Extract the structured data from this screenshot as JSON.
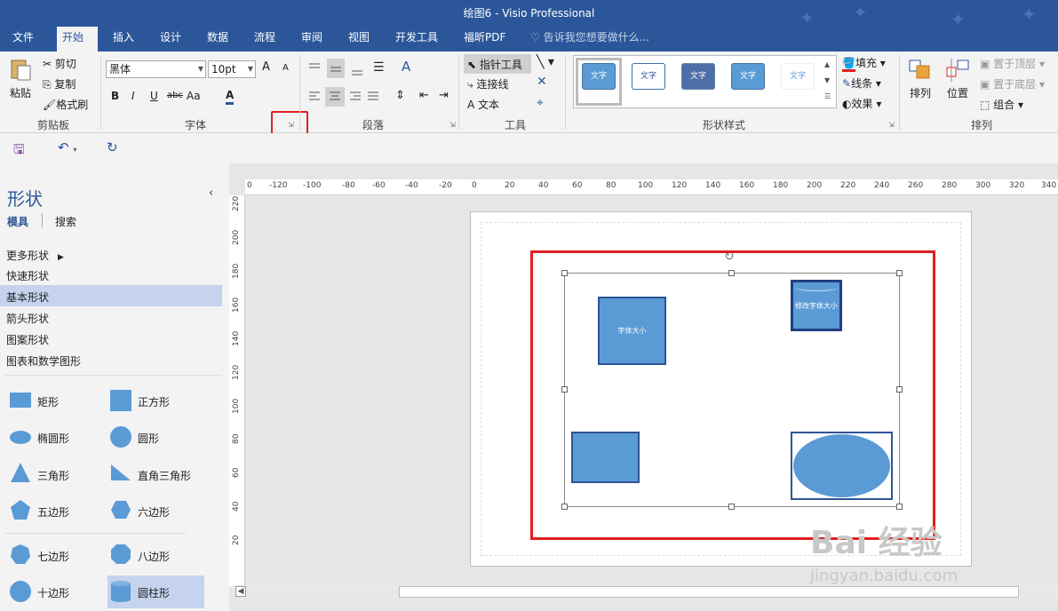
{
  "window": {
    "title": "绘图6 - Visio Professional"
  },
  "tabs": [
    "文件",
    "开始",
    "插入",
    "设计",
    "数据",
    "流程",
    "审阅",
    "视图",
    "开发工具",
    "福昕PDF"
  ],
  "active_tab": "开始",
  "tell_me": "告诉我您想要做什么...",
  "clipboard": {
    "paste": "粘贴",
    "cut": "剪切",
    "copy": "复制",
    "format_painter": "格式刷",
    "label": "剪贴板"
  },
  "font": {
    "name": "黑体",
    "size": "10pt",
    "label": "字体",
    "bold": "B",
    "italic": "I",
    "underline": "U",
    "strike": "abc",
    "case": "Aa",
    "color": "A",
    "grow": "A",
    "shrink": "A"
  },
  "paragraph": {
    "label": "段落"
  },
  "tools": {
    "pointer": "指针工具",
    "connector": "连接线",
    "text": "文本",
    "label": "工具"
  },
  "shape_styles": {
    "sample": "文字",
    "label": "形状样式",
    "fill": "填充",
    "line": "线条",
    "effects": "效果"
  },
  "arrange": {
    "arrange": "排列",
    "position": "位置",
    "bring_front": "置于顶层",
    "send_back": "置于底层",
    "group": "组合",
    "label": "排列"
  },
  "shapes_panel": {
    "title": "形状",
    "tab_stencils": "模具",
    "tab_search": "搜索",
    "categories": [
      "更多形状",
      "快速形状",
      "基本形状",
      "箭头形状",
      "图案形状",
      "图表和数学图形"
    ],
    "selected_category": "基本形状",
    "stencils": [
      "矩形",
      "正方形",
      "椭圆形",
      "圆形",
      "三角形",
      "直角三角形",
      "五边形",
      "六边形",
      "七边形",
      "八边形",
      "十边形",
      "圆柱形"
    ]
  },
  "ruler": {
    "h_labels": [
      "0",
      "-120",
      "-100",
      "-80",
      "-60",
      "-40",
      "-20",
      "0",
      "20",
      "40",
      "60",
      "80",
      "100",
      "120",
      "140",
      "160",
      "180",
      "200",
      "220",
      "240",
      "260",
      "280",
      "300",
      "320",
      "340"
    ],
    "v_labels": [
      "220",
      "200",
      "180",
      "160",
      "140",
      "120",
      "100",
      "80",
      "60",
      "40",
      "20"
    ]
  },
  "canvas_shapes": {
    "square_text": "字体大小",
    "cylinder_text": "修改字体大小"
  },
  "watermark": {
    "brand": "Bai 经验",
    "url": "jingyan.baidu.com"
  },
  "colors": {
    "ribbon_blue": "#2b579a",
    "shape_fill": "#5b9bd5",
    "shape_border": "#2f5597",
    "highlight_red": "#e02020"
  }
}
